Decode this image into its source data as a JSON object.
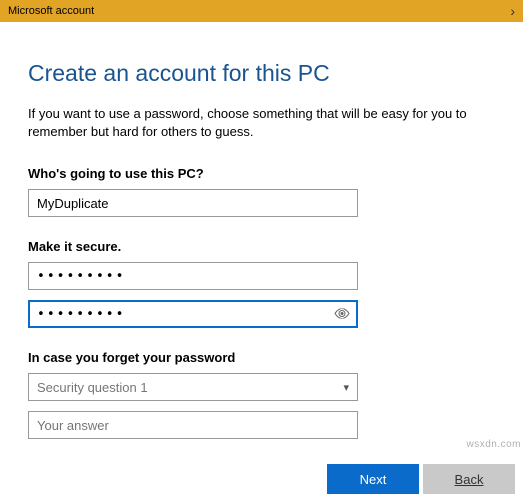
{
  "titlebar": {
    "title": "Microsoft account"
  },
  "page": {
    "heading": "Create an account for this PC",
    "description": "If you want to use a password, choose something that will be easy for you to remember but hard for others to guess."
  },
  "who": {
    "label": "Who's going to use this PC?",
    "value": "MyDuplicate"
  },
  "secure": {
    "label": "Make it secure.",
    "password1": "•••••••••",
    "password2": "•••••••••"
  },
  "forget": {
    "label": "In case you forget your password",
    "question_placeholder": "Security question 1",
    "answer_placeholder": "Your answer"
  },
  "buttons": {
    "next": "Next",
    "back": "Back"
  },
  "watermark": "wsxdn.com"
}
